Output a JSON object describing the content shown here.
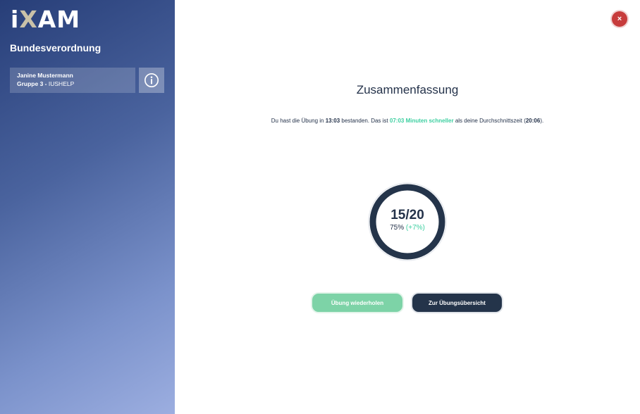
{
  "sidebar": {
    "logo": {
      "prefix": "i",
      "x": "X",
      "suffix": "AM"
    },
    "title": "Bundesverordnung",
    "user": {
      "name": "Janine Mustermann",
      "group_label": "Gruppe 3 -",
      "group_code": "IUSHELP"
    },
    "info_icon": "info-circle-icon"
  },
  "close_icon": "close-icon",
  "close_glyph": "×",
  "main": {
    "title": "Zusammenfassung",
    "summary": {
      "part1": "Du hast die Übung in ",
      "time": "13:03",
      "part2": " bestanden. Das ist ",
      "faster": "07:03 Minuten schneller",
      "part3": " als deine Durchschnittszeit (",
      "avg_time": "20:06",
      "part4": ")."
    },
    "result": {
      "score": "15/20",
      "percent": "75%",
      "delta": "(+7%)",
      "fraction": 0.75
    },
    "buttons": {
      "repeat": "Übung wiederholen",
      "overview": "Zur Übungsübersicht"
    }
  },
  "colors": {
    "accent_green": "#3ccfa0",
    "navy": "#24324a",
    "close_red": "#c73c3c",
    "button_green": "#7dd3a7"
  }
}
